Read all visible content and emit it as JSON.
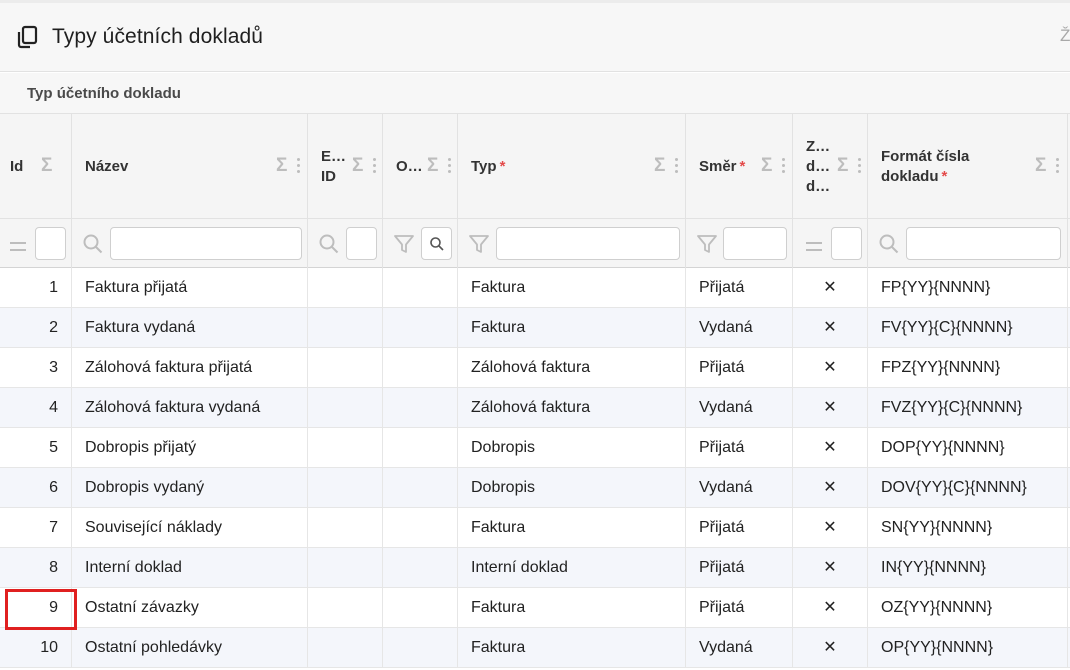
{
  "page": {
    "title": "Typy účetních dokladů",
    "top_right_fragment": "Ž"
  },
  "section": {
    "title": "Typ účetního dokladu"
  },
  "icons": {
    "title": "copy-icon",
    "aggregate": "sigma-icon",
    "search": "search-icon",
    "filter": "filter-icon",
    "equals": "equals-icon",
    "menu": "column-menu-icon",
    "flag": "x-mark"
  },
  "colors": {
    "required": "#e34a4a",
    "highlight": "#e02020",
    "row_alt": "#f4f6fb"
  },
  "columns": [
    {
      "key": "id",
      "label": "Id",
      "required": false
    },
    {
      "key": "name",
      "label": "Název",
      "required": false
    },
    {
      "key": "ext_id",
      "label": "E… ID",
      "line1": "E…",
      "line2": "ID",
      "required": false
    },
    {
      "key": "o",
      "label": "O…",
      "required": false
    },
    {
      "key": "type",
      "label": "Typ",
      "required": true
    },
    {
      "key": "direction",
      "label": "Směr",
      "required": true
    },
    {
      "key": "z",
      "label": "Z… d… d…",
      "line1": "Z…",
      "line2": "d…",
      "line3": "d…",
      "required": false
    },
    {
      "key": "format",
      "label": "Formát čísla dokladu",
      "line1": "Formát čísla",
      "line2": "dokladu",
      "required": true
    }
  ],
  "required_mark": "*",
  "rows": [
    {
      "id": "1",
      "name": "Faktura přijatá",
      "type": "Faktura",
      "direction": "Přijatá",
      "flag": "✕",
      "format": "FP{YY}{NNNN}"
    },
    {
      "id": "2",
      "name": "Faktura vydaná",
      "type": "Faktura",
      "direction": "Vydaná",
      "flag": "✕",
      "format": "FV{YY}{C}{NNNN}"
    },
    {
      "id": "3",
      "name": "Zálohová faktura přijatá",
      "type": "Zálohová faktura",
      "direction": "Přijatá",
      "flag": "✕",
      "format": "FPZ{YY}{NNNN}"
    },
    {
      "id": "4",
      "name": "Zálohová faktura vydaná",
      "type": "Zálohová faktura",
      "direction": "Vydaná",
      "flag": "✕",
      "format": "FVZ{YY}{C}{NNNN}"
    },
    {
      "id": "5",
      "name": "Dobropis přijatý",
      "type": "Dobropis",
      "direction": "Přijatá",
      "flag": "✕",
      "format": "DOP{YY}{NNNN}"
    },
    {
      "id": "6",
      "name": "Dobropis vydaný",
      "type": "Dobropis",
      "direction": "Vydaná",
      "flag": "✕",
      "format": "DOV{YY}{C}{NNNN}"
    },
    {
      "id": "7",
      "name": "Související náklady",
      "type": "Faktura",
      "direction": "Přijatá",
      "flag": "✕",
      "format": "SN{YY}{NNNN}"
    },
    {
      "id": "8",
      "name": "Interní doklad",
      "type": "Interní doklad",
      "direction": "Přijatá",
      "flag": "✕",
      "format": "IN{YY}{NNNN}"
    },
    {
      "id": "9",
      "name": "Ostatní závazky",
      "type": "Faktura",
      "direction": "Přijatá",
      "flag": "✕",
      "format": "OZ{YY}{NNNN}"
    },
    {
      "id": "10",
      "name": "Ostatní pohledávky",
      "type": "Faktura",
      "direction": "Vydaná",
      "flag": "✕",
      "format": "OP{YY}{NNNN}"
    }
  ]
}
